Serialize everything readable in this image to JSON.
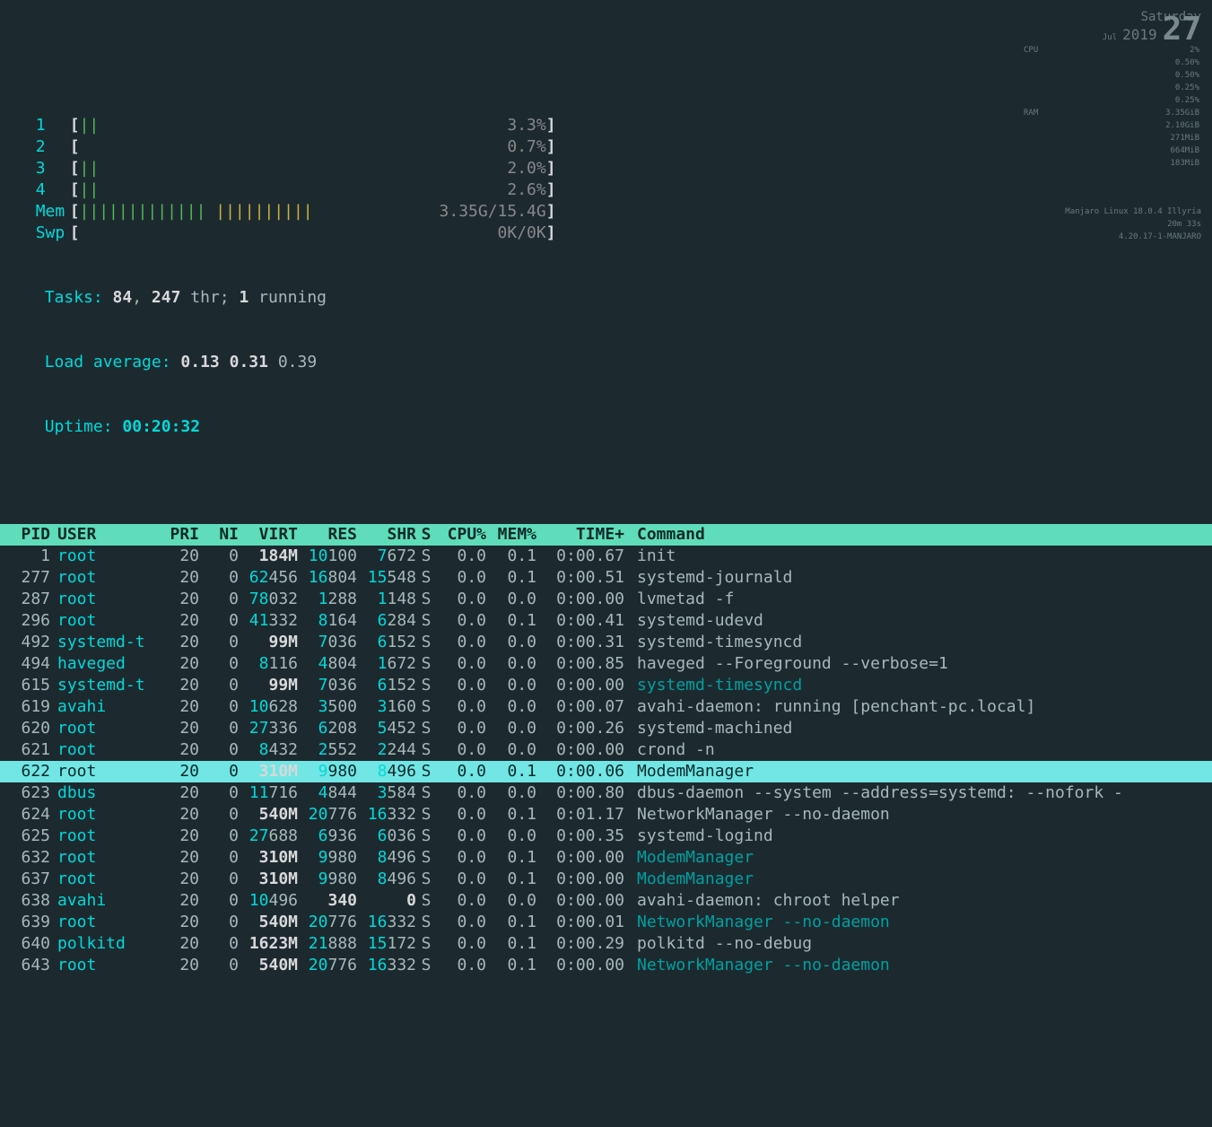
{
  "meters": {
    "cpu": [
      {
        "label": "1",
        "bar": "||",
        "pct": "3.3%"
      },
      {
        "label": "2",
        "bar": "",
        "pct": "0.7%"
      },
      {
        "label": "3",
        "bar": "||",
        "pct": "2.0%"
      },
      {
        "label": "4",
        "bar": "||",
        "pct": "2.6%"
      }
    ],
    "mem": {
      "label": "Mem",
      "bar_g": "||||||||||||| ",
      "bar_y": "||||||||||",
      "val": "3.35G/15.4G"
    },
    "swp": {
      "label": "Swp",
      "val": "0K/0K"
    }
  },
  "stats": {
    "tasks_label": "Tasks: ",
    "tasks": "84",
    "tasks_sep": ", ",
    "threads": "247",
    "thr_txt": " thr; ",
    "running": "1",
    "running_txt": " running",
    "load_label": "Load average: ",
    "la1": "0.13",
    "la2": "0.31",
    "la3": "0.39",
    "uptime_label": "Uptime: ",
    "uptime": "00:20:32"
  },
  "header": {
    "pid": "PID",
    "user": "USER",
    "pri": "PRI",
    "ni": "NI",
    "virt": "VIRT",
    "res": "RES",
    "shr": "SHR",
    "s": "S",
    "cpu": "CPU%",
    "mem": "MEM%",
    "time": "TIME+",
    "cmd": "Command"
  },
  "procs": [
    {
      "pid": "1",
      "user": "root",
      "pri": "20",
      "ni": "0",
      "virt": "184M",
      "vlead": "",
      "res": "10100",
      "rlead": "10",
      "shr": "7672",
      "slead": "7",
      "s": "S",
      "cpu": "0.0",
      "mem": "0.1",
      "time": "0:00.67",
      "cmd": "init",
      "dim": false,
      "sel": false
    },
    {
      "pid": "277",
      "user": "root",
      "pri": "20",
      "ni": "0",
      "virt": "62456",
      "vlead": "62",
      "res": "16804",
      "rlead": "16",
      "shr": "15548",
      "slead": "15",
      "s": "S",
      "cpu": "0.0",
      "mem": "0.1",
      "time": "0:00.51",
      "cmd": "systemd-journald",
      "dim": false,
      "sel": false
    },
    {
      "pid": "287",
      "user": "root",
      "pri": "20",
      "ni": "0",
      "virt": "78032",
      "vlead": "78",
      "res": "1288",
      "rlead": "1",
      "shr": "1148",
      "slead": "1",
      "s": "S",
      "cpu": "0.0",
      "mem": "0.0",
      "time": "0:00.00",
      "cmd": "lvmetad -f",
      "dim": false,
      "sel": false
    },
    {
      "pid": "296",
      "user": "root",
      "pri": "20",
      "ni": "0",
      "virt": "41332",
      "vlead": "41",
      "res": "8164",
      "rlead": "8",
      "shr": "6284",
      "slead": "6",
      "s": "S",
      "cpu": "0.0",
      "mem": "0.1",
      "time": "0:00.41",
      "cmd": "systemd-udevd",
      "dim": false,
      "sel": false
    },
    {
      "pid": "492",
      "user": "systemd-t",
      "pri": "20",
      "ni": "0",
      "virt": "99M",
      "vlead": "",
      "res": "7036",
      "rlead": "7",
      "shr": "6152",
      "slead": "6",
      "s": "S",
      "cpu": "0.0",
      "mem": "0.0",
      "time": "0:00.31",
      "cmd": "systemd-timesyncd",
      "dim": false,
      "sel": false
    },
    {
      "pid": "494",
      "user": "haveged",
      "pri": "20",
      "ni": "0",
      "virt": "8116",
      "vlead": "8",
      "res": "4804",
      "rlead": "4",
      "shr": "1672",
      "slead": "1",
      "s": "S",
      "cpu": "0.0",
      "mem": "0.0",
      "time": "0:00.85",
      "cmd": "haveged --Foreground --verbose=1",
      "dim": false,
      "sel": false
    },
    {
      "pid": "615",
      "user": "systemd-t",
      "pri": "20",
      "ni": "0",
      "virt": "99M",
      "vlead": "",
      "res": "7036",
      "rlead": "7",
      "shr": "6152",
      "slead": "6",
      "s": "S",
      "cpu": "0.0",
      "mem": "0.0",
      "time": "0:00.00",
      "cmd": "systemd-timesyncd",
      "dim": true,
      "sel": false
    },
    {
      "pid": "619",
      "user": "avahi",
      "pri": "20",
      "ni": "0",
      "virt": "10628",
      "vlead": "10",
      "res": "3500",
      "rlead": "3",
      "shr": "3160",
      "slead": "3",
      "s": "S",
      "cpu": "0.0",
      "mem": "0.0",
      "time": "0:00.07",
      "cmd": "avahi-daemon: running [penchant-pc.local]",
      "dim": false,
      "sel": false
    },
    {
      "pid": "620",
      "user": "root",
      "pri": "20",
      "ni": "0",
      "virt": "27336",
      "vlead": "27",
      "res": "6208",
      "rlead": "6",
      "shr": "5452",
      "slead": "5",
      "s": "S",
      "cpu": "0.0",
      "mem": "0.0",
      "time": "0:00.26",
      "cmd": "systemd-machined",
      "dim": false,
      "sel": false
    },
    {
      "pid": "621",
      "user": "root",
      "pri": "20",
      "ni": "0",
      "virt": "8432",
      "vlead": "8",
      "res": "2552",
      "rlead": "2",
      "shr": "2244",
      "slead": "2",
      "s": "S",
      "cpu": "0.0",
      "mem": "0.0",
      "time": "0:00.00",
      "cmd": "crond -n",
      "dim": false,
      "sel": false
    },
    {
      "pid": "622",
      "user": "root",
      "pri": "20",
      "ni": "0",
      "virt": "310M",
      "vlead": "",
      "res": "9980",
      "rlead": "9",
      "shr": "8496",
      "slead": "8",
      "s": "S",
      "cpu": "0.0",
      "mem": "0.1",
      "time": "0:00.06",
      "cmd": "ModemManager",
      "dim": false,
      "sel": true
    },
    {
      "pid": "623",
      "user": "dbus",
      "pri": "20",
      "ni": "0",
      "virt": "11716",
      "vlead": "11",
      "res": "4844",
      "rlead": "4",
      "shr": "3584",
      "slead": "3",
      "s": "S",
      "cpu": "0.0",
      "mem": "0.0",
      "time": "0:00.80",
      "cmd": "dbus-daemon --system --address=systemd: --nofork -",
      "dim": false,
      "sel": false
    },
    {
      "pid": "624",
      "user": "root",
      "pri": "20",
      "ni": "0",
      "virt": "540M",
      "vlead": "",
      "res": "20776",
      "rlead": "20",
      "shr": "16332",
      "slead": "16",
      "s": "S",
      "cpu": "0.0",
      "mem": "0.1",
      "time": "0:01.17",
      "cmd": "NetworkManager --no-daemon",
      "dim": false,
      "sel": false
    },
    {
      "pid": "625",
      "user": "root",
      "pri": "20",
      "ni": "0",
      "virt": "27688",
      "vlead": "27",
      "res": "6936",
      "rlead": "6",
      "shr": "6036",
      "slead": "6",
      "s": "S",
      "cpu": "0.0",
      "mem": "0.0",
      "time": "0:00.35",
      "cmd": "systemd-logind",
      "dim": false,
      "sel": false
    },
    {
      "pid": "632",
      "user": "root",
      "pri": "20",
      "ni": "0",
      "virt": "310M",
      "vlead": "",
      "res": "9980",
      "rlead": "9",
      "shr": "8496",
      "slead": "8",
      "s": "S",
      "cpu": "0.0",
      "mem": "0.1",
      "time": "0:00.00",
      "cmd": "ModemManager",
      "dim": true,
      "sel": false
    },
    {
      "pid": "637",
      "user": "root",
      "pri": "20",
      "ni": "0",
      "virt": "310M",
      "vlead": "",
      "res": "9980",
      "rlead": "9",
      "shr": "8496",
      "slead": "8",
      "s": "S",
      "cpu": "0.0",
      "mem": "0.1",
      "time": "0:00.00",
      "cmd": "ModemManager",
      "dim": true,
      "sel": false
    },
    {
      "pid": "638",
      "user": "avahi",
      "pri": "20",
      "ni": "0",
      "virt": "10496",
      "vlead": "10",
      "res": "340",
      "rlead": "",
      "shr": "0",
      "slead": "",
      "s": "S",
      "cpu": "0.0",
      "mem": "0.0",
      "time": "0:00.00",
      "cmd": "avahi-daemon: chroot helper",
      "dim": false,
      "sel": false
    },
    {
      "pid": "639",
      "user": "root",
      "pri": "20",
      "ni": "0",
      "virt": "540M",
      "vlead": "",
      "res": "20776",
      "rlead": "20",
      "shr": "16332",
      "slead": "16",
      "s": "S",
      "cpu": "0.0",
      "mem": "0.1",
      "time": "0:00.01",
      "cmd": "NetworkManager --no-daemon",
      "dim": true,
      "sel": false
    },
    {
      "pid": "640",
      "user": "polkitd",
      "pri": "20",
      "ni": "0",
      "virt": "1623M",
      "vlead": "",
      "res": "21888",
      "rlead": "21",
      "shr": "15172",
      "slead": "15",
      "s": "S",
      "cpu": "0.0",
      "mem": "0.1",
      "time": "0:00.29",
      "cmd": "polkitd --no-debug",
      "dim": false,
      "sel": false
    },
    {
      "pid": "643",
      "user": "root",
      "pri": "20",
      "ni": "0",
      "virt": "540M",
      "vlead": "",
      "res": "20776",
      "rlead": "20",
      "shr": "16332",
      "slead": "16",
      "s": "S",
      "cpu": "0.0",
      "mem": "0.1",
      "time": "0:00.00",
      "cmd": "NetworkManager --no-daemon",
      "dim": true,
      "sel": false
    }
  ],
  "conky": {
    "weekday": "Saturday",
    "month": "Jul",
    "year": "2019",
    "day": "27",
    "cpu_label": "CPU",
    "cpu_val": "2%",
    "rows": [
      [
        "",
        "0.50%"
      ],
      [
        "",
        "0.50%"
      ],
      [
        "",
        "0.25%"
      ],
      [
        "",
        "0.25%"
      ]
    ],
    "ram_label": "RAM",
    "ram_val": "3.35GiB",
    "detail": [
      [
        "",
        "2.10GiB"
      ],
      [
        "",
        "271MiB"
      ],
      [
        "",
        "664MiB"
      ],
      [
        "",
        "183MiB"
      ]
    ],
    "distro": "Manjaro Linux 18.0.4 Illyria",
    "uptime": "20m 33s",
    "kernel": "4.20.17-1-MANJARO"
  }
}
